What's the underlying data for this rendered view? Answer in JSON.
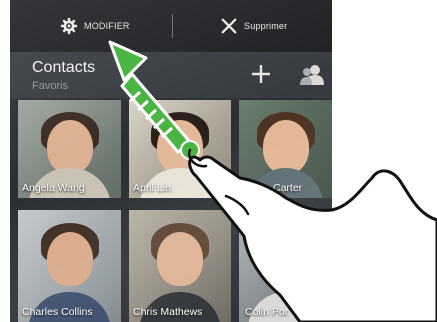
{
  "action_bar": {
    "modify_label": "MODIFIER",
    "modify_icon": "gear-icon",
    "delete_label": "Supprimer",
    "delete_icon": "close-icon"
  },
  "header": {
    "title": "Contacts",
    "subtitle": "Favoris",
    "add_icon": "plus-icon",
    "people_icon": "person-icon"
  },
  "contacts": [
    {
      "name": "Angela Wang"
    },
    {
      "name": "April Lin"
    },
    {
      "name": "Carter"
    },
    {
      "name": "Charles Collins"
    },
    {
      "name": "Chris Mathews"
    },
    {
      "name": "Colin Por"
    }
  ],
  "colors": {
    "accent_green": "#4bb543",
    "action_bar_bg": "#1d1f22"
  }
}
